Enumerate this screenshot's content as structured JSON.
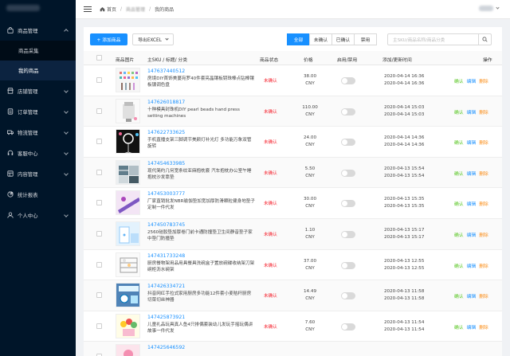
{
  "header": {
    "breadcrumb_home": "首页",
    "breadcrumb_mid": "商品管理",
    "breadcrumb_current": "我的商品"
  },
  "sidebar": {
    "items": [
      {
        "label": "商品管理",
        "icon": "shopping-bag-icon"
      },
      {
        "label": "店铺管理",
        "icon": "store-icon"
      },
      {
        "label": "订单管理",
        "icon": "order-icon"
      },
      {
        "label": "物流管理",
        "icon": "truck-icon"
      },
      {
        "label": "客服中心",
        "icon": "headset-icon"
      },
      {
        "label": "内容管理",
        "icon": "content-icon"
      },
      {
        "label": "统计报表",
        "icon": "chart-icon"
      },
      {
        "label": "个人中心",
        "icon": "user-icon"
      }
    ],
    "sub_items": [
      {
        "label": "商品采集"
      },
      {
        "label": "我的商品"
      }
    ]
  },
  "toolbar": {
    "add_label": "+ 添加商品",
    "export_label": "导出EXCEL",
    "filters": [
      "全部",
      "未确认",
      "已确认",
      "禁用"
    ],
    "search_placeholder": "主SKU/商品名称/商品分类"
  },
  "table": {
    "headers": [
      "商品图片",
      "主SKU / 标题/ 分类",
      "商品状态",
      "价格",
      "启用/禁用",
      "添加/更新时间",
      "操作"
    ],
    "ops": {
      "confirm": "确认",
      "edit": "编辑",
      "delete": "删除"
    },
    "rows": [
      {
        "sku": "147637440512",
        "name": "房境DIY首饰美蔓宛罗40件套亮晶镶板钥珠棒点钻棒镶板镀调色盘",
        "status": "未确认",
        "price": "38.00",
        "currency": "CNY",
        "added": "2020-04-14 16:36",
        "updated": "2020-04-14 16:36"
      },
      {
        "sku": "147626018817",
        "name": "十种模具封珠机DIY pearl beads hand press setting machines",
        "status": "未确认",
        "price": "110.00",
        "currency": "CNY",
        "added": "2020-04-14 15:03",
        "updated": "2020-04-14 15:03"
      },
      {
        "sku": "147622733625",
        "name": "手机直播支架三脚调节美颜灯补光灯 多功能万象双管旋转",
        "status": "未确认",
        "price": "24.00",
        "currency": "CNY",
        "added": "2020-04-14 14:36",
        "updated": "2020-04-14 14:36"
      },
      {
        "sku": "147454633985",
        "name": "现代简约几何宽条纹亚麻抱枕套 汽车抱枕办公室午睡抱枕沙发靠垫",
        "status": "未确认",
        "price": "5.50",
        "currency": "CNY",
        "added": "2020-04-13 15:54",
        "updated": "2020-04-13 15:54"
      },
      {
        "sku": "147453003777",
        "name": "厂家直销批发NBR瑜伽垫加宽加厚防滑颗粒健身地垫子定制一件代发",
        "status": "未确认",
        "price": "30.00",
        "currency": "CNY",
        "added": "2020-04-13 15:35",
        "updated": "2020-04-13 15:35"
      },
      {
        "sku": "147450783745",
        "name": "2560硅胶垫加厚卷门前卡通防撞垫卫生间静音垫子家中垫门防撞垫",
        "status": "未确认",
        "price": "1.10",
        "currency": "CNY",
        "added": "2020-04-13 15:17",
        "updated": "2020-04-13 15:17"
      },
      {
        "sku": "147431733248",
        "name": "厨房餐物架用品用具餐具洗碗盒子置放碗碟收纳架刀架碗柜沥水碗架",
        "status": "未确认",
        "price": "37.00",
        "currency": "CNY",
        "added": "2020-04-13 12:55",
        "updated": "2020-04-13 12:55"
      },
      {
        "sku": "147426334721",
        "name": "抖音网红手拉式家用厨房多功能12件套小麦秸秆厨房切菜切丝神器",
        "status": "未确认",
        "price": "14.49",
        "currency": "CNY",
        "added": "2020-04-13 11:58",
        "updated": "2020-04-13 11:58"
      },
      {
        "sku": "147425873921",
        "name": "儿童礼品玩具真人鱼4只排偶套装幼儿发玩手摇玩偶讲故事一件代发",
        "status": "未确认",
        "price": "7.60",
        "currency": "CNY",
        "added": "2020-04-13 11:54",
        "updated": "2020-04-13 11:54"
      },
      {
        "sku": "147425646592",
        "name": "",
        "status": "",
        "price": "",
        "currency": "",
        "added": "",
        "updated": ""
      }
    ]
  },
  "colors": {
    "primary": "#1890ff",
    "sidebar_bg": "#001529",
    "status_red": "#f5222d",
    "confirm_green": "#52c41a",
    "delete_orange": "#fa8c16"
  }
}
